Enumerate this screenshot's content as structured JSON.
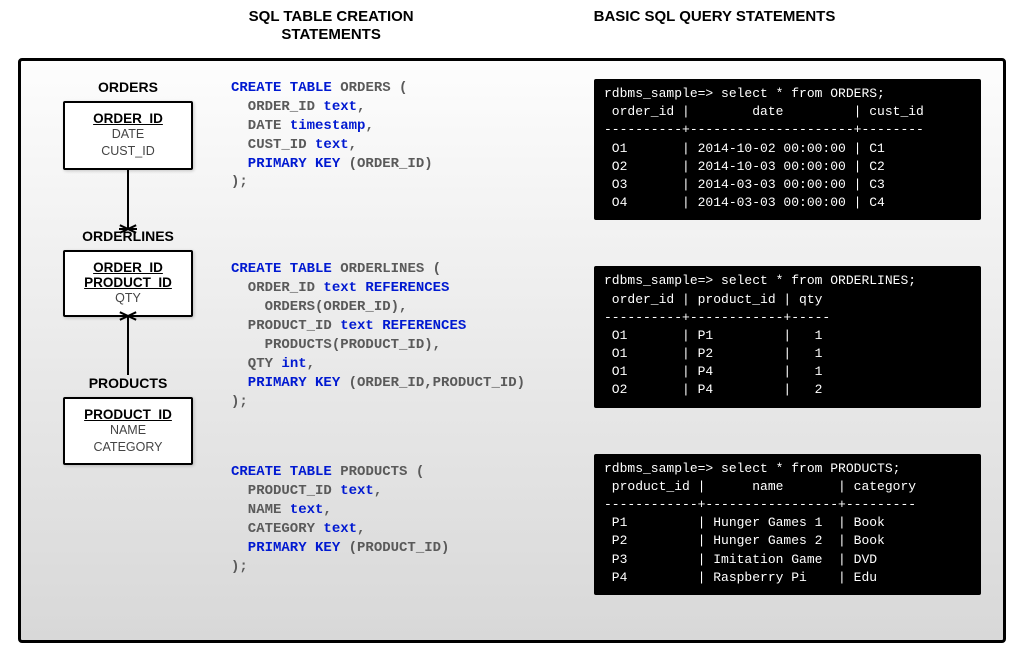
{
  "headers": {
    "left": "SQL TABLE CREATION\nSTATEMENTS",
    "right": "BASIC SQL QUERY STATEMENTS"
  },
  "entities": {
    "orders": {
      "label": "ORDERS",
      "pk": "ORDER_ID",
      "attrs": [
        "DATE",
        "CUST_ID"
      ]
    },
    "orderlines": {
      "label": "ORDERLINES",
      "pk": "ORDER_ID\nPRODUCT_ID",
      "attrs": [
        "QTY"
      ]
    },
    "products": {
      "label": "PRODUCTS",
      "pk": "PRODUCT_ID",
      "attrs": [
        "NAME",
        "CATEGORY"
      ]
    }
  },
  "sql": {
    "orders": {
      "create": "CREATE TABLE",
      "name": "ORDERS",
      "lines": [
        {
          "col": "  ORDER_ID ",
          "type": "text",
          "tail": ","
        },
        {
          "col": "  DATE ",
          "type": "timestamp",
          "tail": ","
        },
        {
          "col": "  CUST_ID ",
          "type": "text",
          "tail": ","
        },
        {
          "kw": "  PRIMARY KEY ",
          "tail": "(ORDER_ID)"
        }
      ]
    },
    "orderlines": {
      "create": "CREATE TABLE",
      "name": "ORDERLINES",
      "lines": [
        {
          "col": "  ORDER_ID ",
          "type": "text",
          "ref": " REFERENCES",
          "tail2": "    ORDERS(ORDER_ID),"
        },
        {
          "col": "  PRODUCT_ID ",
          "type": "text",
          "ref": " REFERENCES",
          "tail2": "    PRODUCTS(PRODUCT_ID),"
        },
        {
          "col": "  QTY ",
          "type": "int",
          "tail": ","
        },
        {
          "kw": "  PRIMARY KEY ",
          "tail": "(ORDER_ID,PRODUCT_ID)"
        }
      ]
    },
    "products": {
      "create": "CREATE TABLE",
      "name": "PRODUCTS",
      "lines": [
        {
          "col": "  PRODUCT_ID ",
          "type": "text",
          "tail": ","
        },
        {
          "col": "  NAME ",
          "type": "text",
          "tail": ","
        },
        {
          "col": "  CATEGORY ",
          "type": "text",
          "tail": ","
        },
        {
          "kw": "  PRIMARY KEY ",
          "tail": "(PRODUCT_ID)"
        }
      ]
    }
  },
  "queries": {
    "orders": {
      "prompt": "rdbms_sample=> select * from ORDERS;",
      "header": " order_id |        date         | cust_id",
      "sep": "----------+---------------------+--------",
      "rows": [
        " O1       | 2014-10-02 00:00:00 | C1",
        " O2       | 2014-10-03 00:00:00 | C2",
        " O3       | 2014-03-03 00:00:00 | C3",
        " O4       | 2014-03-03 00:00:00 | C4"
      ]
    },
    "orderlines": {
      "prompt": "rdbms_sample=> select * from ORDERLINES;",
      "header": " order_id | product_id | qty",
      "sep": "----------+------------+-----",
      "rows": [
        " O1       | P1         |   1",
        " O1       | P2         |   1",
        " O1       | P4         |   1",
        " O2       | P4         |   2"
      ]
    },
    "products": {
      "prompt": "rdbms_sample=> select * from PRODUCTS;",
      "header": " product_id |      name       | category",
      "sep": "------------+-----------------+---------",
      "rows": [
        " P1         | Hunger Games 1  | Book",
        " P2         | Hunger Games 2  | Book",
        " P3         | Imitation Game  | DVD",
        " P4         | Raspberry Pi    | Edu"
      ]
    }
  }
}
